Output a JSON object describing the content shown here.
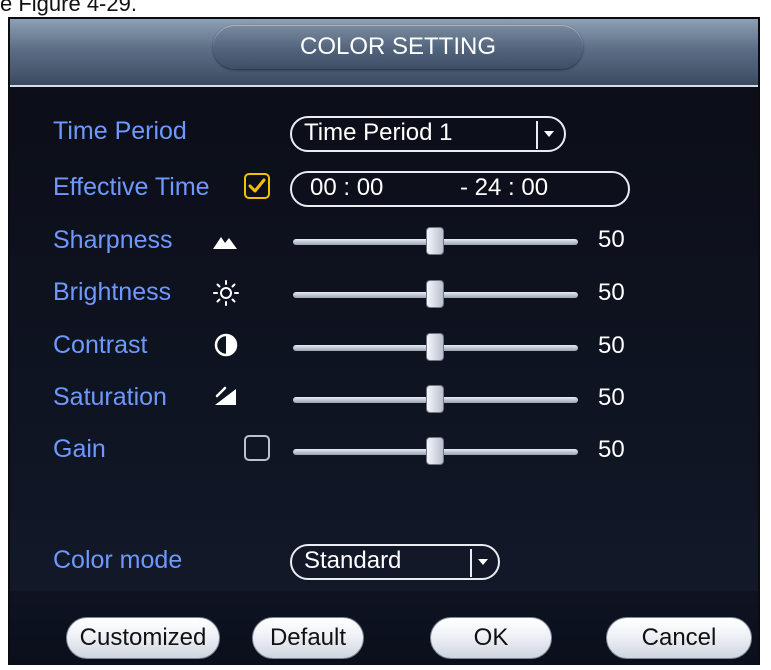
{
  "caption": "e Figure 4-29.",
  "dialog": {
    "title": "COLOR SETTING",
    "rows": {
      "time_period_label": "Time Period",
      "time_period_value": "Time Period 1",
      "effective_time_label": "Effective Time",
      "effective_time_enabled": true,
      "start_time": "00 : 00",
      "end_time": "- 24 :  00",
      "sharpness_label": "Sharpness",
      "sharpness_value": "50",
      "brightness_label": "Brightness",
      "brightness_value": "50",
      "contrast_label": "Contrast",
      "contrast_value": "50",
      "saturation_label": "Saturation",
      "saturation_value": "50",
      "gain_label": "Gain",
      "gain_enabled": false,
      "gain_value": "50",
      "color_mode_label": "Color mode",
      "color_mode_value": "Standard"
    },
    "buttons": {
      "customized": "Customized",
      "default": "Default",
      "ok": "OK",
      "cancel": "Cancel"
    },
    "icons": {
      "sharpness": "mountain-icon",
      "brightness": "sun-icon",
      "contrast": "half-circle-icon",
      "saturation": "saturation-icon",
      "dropdown": "chevron-down-icon",
      "checkbox_checked": "checkmark-icon"
    },
    "colors": {
      "label": "#6f98ff",
      "checkbox_on": "#f2c200",
      "background": "#0f1422"
    }
  }
}
